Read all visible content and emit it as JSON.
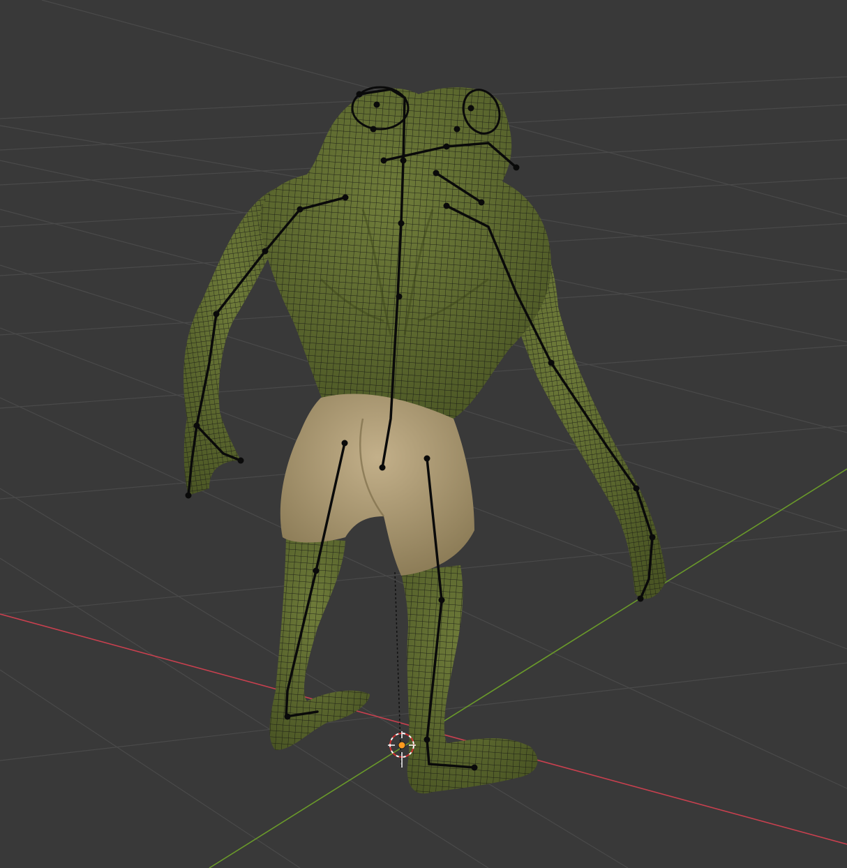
{
  "viewport": {
    "background_color": "#393939",
    "grid_color": "#4a4a4a",
    "x_axis_color": "#c9404f",
    "y_axis_color": "#6a9a2a",
    "origin_marker": "3d-cursor-icon",
    "origin_dot_color": "#ff9a1f"
  },
  "scene": {
    "object": "frog-character-mesh",
    "display_mode": "solid-with-wireframe-overlay",
    "skin_color": "#5d6a2e",
    "shorts_color": "#a99670",
    "wire_color": "#111111",
    "armature_color": "#0a0a0a"
  }
}
